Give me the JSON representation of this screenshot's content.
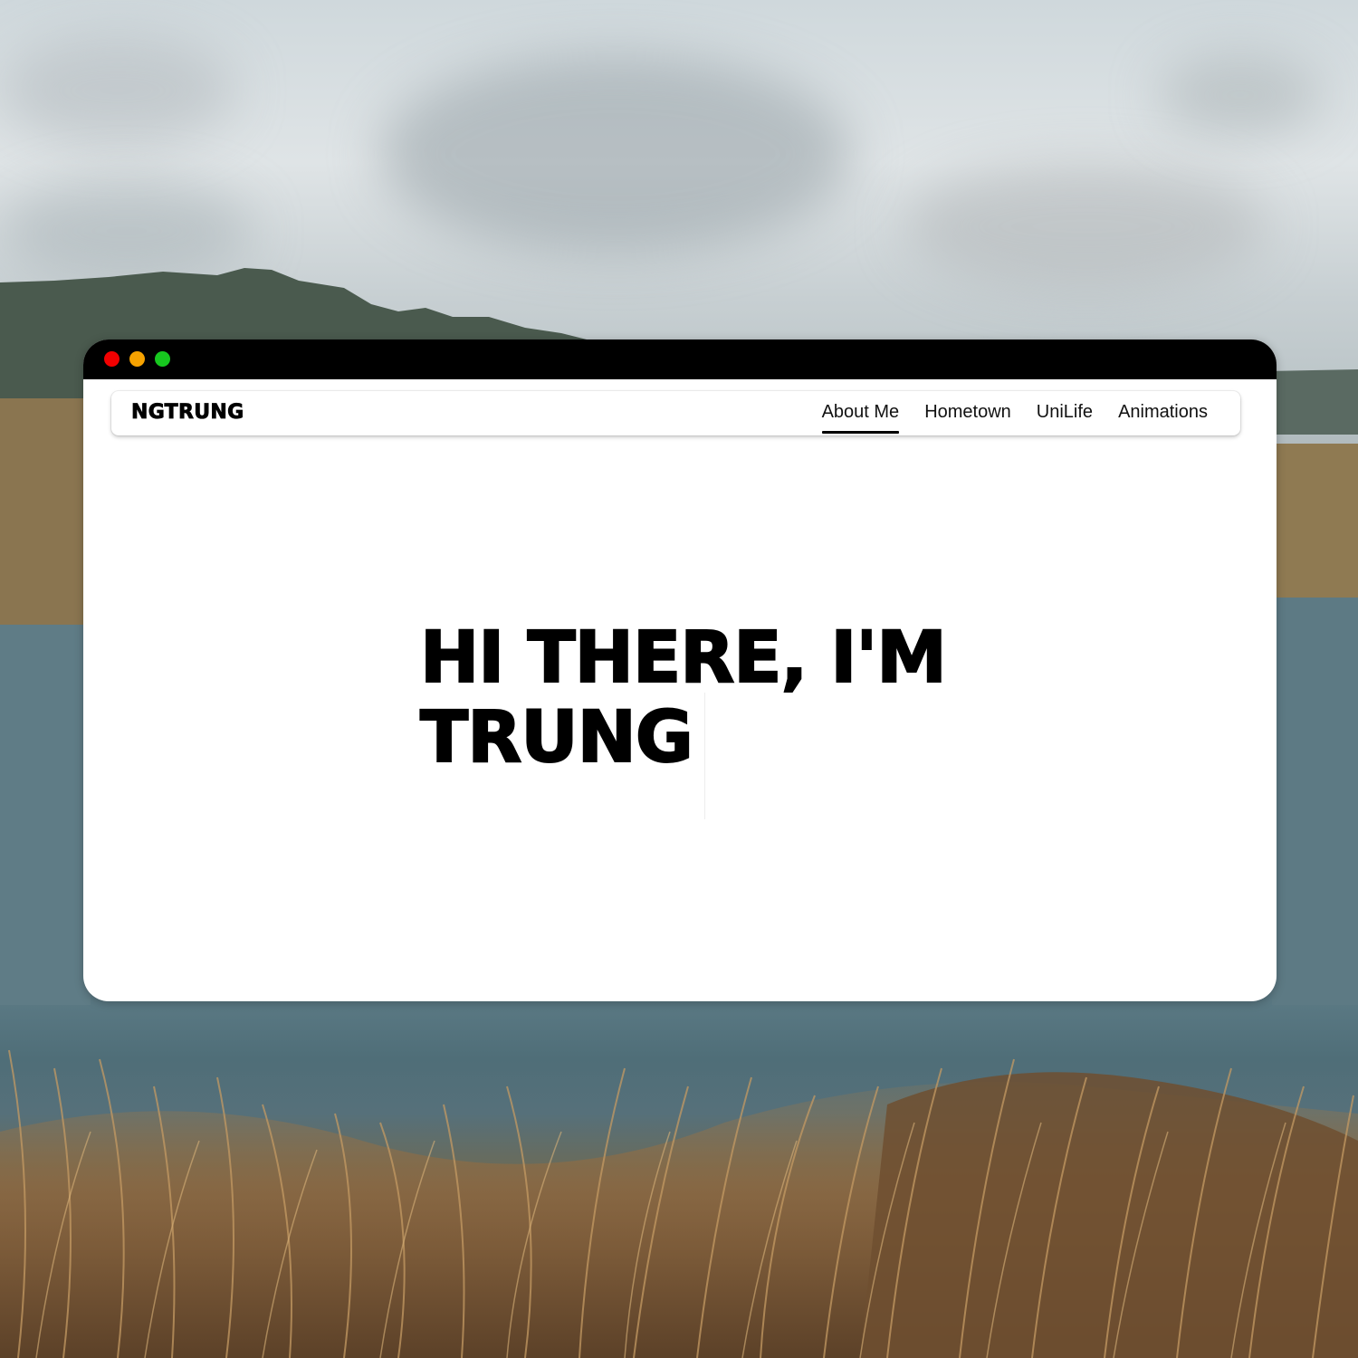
{
  "window": {
    "controls": [
      "close",
      "minimize",
      "maximize"
    ],
    "control_colors": {
      "close": "#f20000",
      "minimize": "#f6a200",
      "maximize": "#17c81f"
    }
  },
  "navbar": {
    "brand": "NGTRUNG",
    "links": [
      {
        "label": "About Me",
        "active": true
      },
      {
        "label": "Hometown",
        "active": false
      },
      {
        "label": "UniLife",
        "active": false
      },
      {
        "label": "Animations",
        "active": false
      }
    ]
  },
  "hero": {
    "line1": "HI THERE, I'M",
    "line2": "TRUNG"
  },
  "background": {
    "description_icon": "landscape-photo"
  }
}
